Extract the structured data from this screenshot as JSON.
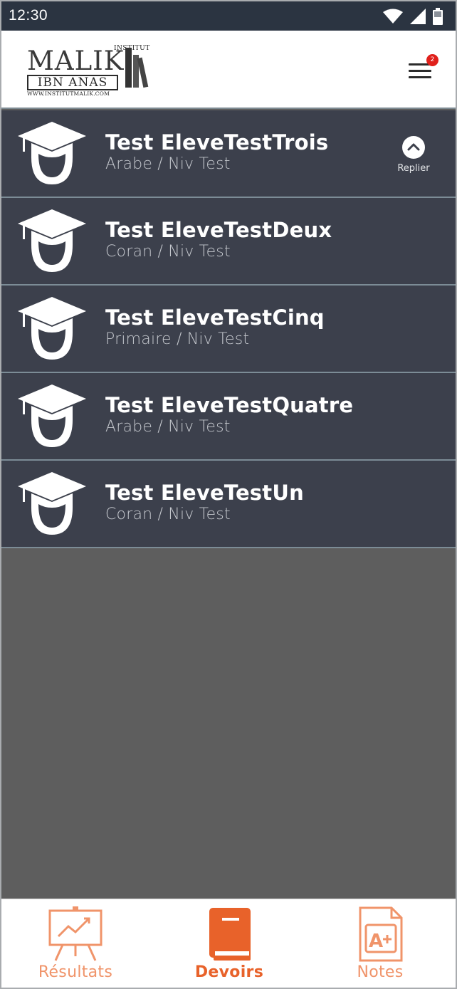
{
  "status_bar": {
    "time": "12:30"
  },
  "header": {
    "logo": {
      "top_text": "INSTITUT",
      "main_text": "MALIK",
      "sub_text": "IBN ANAS",
      "url_text": "WWW.INSTITUTMALIK.COM"
    },
    "menu_badge": "2"
  },
  "students": [
    {
      "name": "Test EleveTestTrois",
      "class": "Arabe / Niv Test"
    },
    {
      "name": "Test EleveTestDeux",
      "class": "Coran / Niv Test"
    },
    {
      "name": "Test EleveTestCinq",
      "class": "Primaire / Niv Test"
    },
    {
      "name": "Test EleveTestQuatre",
      "class": "Arabe / Niv Test"
    },
    {
      "name": "Test EleveTestUn",
      "class": "Coran / Niv Test"
    }
  ],
  "collapse_label": "Replier",
  "bottom_nav": [
    {
      "label": "Résultats",
      "icon": "chart-board-icon",
      "active": false
    },
    {
      "label": "Devoirs",
      "icon": "book-icon",
      "active": true
    },
    {
      "label": "Notes",
      "icon": "grade-document-icon",
      "active": false
    }
  ],
  "colors": {
    "status_bar": "#2b3441",
    "list_item_bg": "#3c404c",
    "list_divider": "#7c8c96",
    "content_bg": "#5e5e5e",
    "accent": "#e8622a",
    "accent_light": "#f0946a",
    "badge": "#e0201b"
  }
}
